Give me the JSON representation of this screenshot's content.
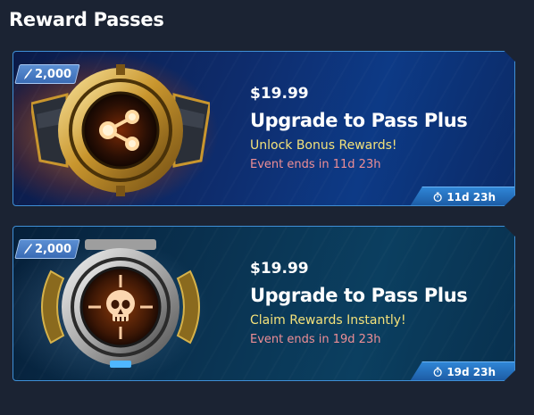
{
  "header": {
    "title": "Reward Passes"
  },
  "passes": [
    {
      "badge": "2,000",
      "price": "$19.99",
      "title": "Upgrade to Pass Plus",
      "subtitle": "Unlock Bonus Rewards!",
      "event": "Event ends in 11d 23h",
      "timer": "11d 23h",
      "emblem_icon": "share-nodes-icon",
      "accent": "#e2a23a"
    },
    {
      "badge": "2,000",
      "price": "$19.99",
      "title": "Upgrade to Pass Plus",
      "subtitle": "Claim Rewards Instantly!",
      "event": "Event ends in 19d 23h",
      "timer": "19d 23h",
      "emblem_icon": "skull-crosshair-icon",
      "accent": "#c9c9c9"
    }
  ]
}
